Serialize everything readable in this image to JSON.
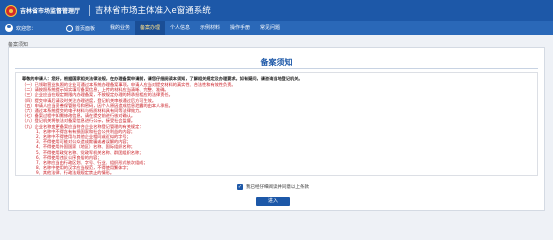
{
  "header": {
    "agency": "吉林省市场监督管理厅",
    "system_title": "吉林省市场主体准入e窗通系统"
  },
  "nav": {
    "user_label": "欢迎您：",
    "home_label": "首页面板",
    "menu": [
      {
        "label": "我的业务",
        "active": false
      },
      {
        "label": "备案办理",
        "active": true
      },
      {
        "label": "个人信息",
        "active": false
      },
      {
        "label": "示例材料",
        "active": false
      },
      {
        "label": "操作手册",
        "active": false
      },
      {
        "label": "常见问题",
        "active": false
      }
    ]
  },
  "breadcrumb": "备案须知",
  "panel": {
    "title": "备案须知",
    "notice_head": "尊敬的申请人：您好，根据国家相关法律法规，在办理备案申请前，请您仔细阅读本须知，了解相关规定及办理要求。如有疑问，请咨询当地登记机关。",
    "notice_lines": [
      "（一）已领取营业执照的企业可通过本系统办理备案事项，申请人应当对提交材料的真实性、合法性和有效性负责。",
      "（二）请按照系统提示如实填写备案信息，上传的材料应当清晰、完整、准确。",
      "（三）企业应当在规定期限内办理备案，不按规定办理的将承担相应的法律责任。",
      "（四）提交申请后请及时关注办理进度，登记机关审核通过后方可生效。",
      "（五）申请人应当妥善保管账号和密码，因个人原因造成信息泄露的由本人承担。",
      "（六）通过本系统提交的电子材料与纸质材料具有同等法律效力。",
      "（七）备案过程中如需修改信息，请在提交前进行核对确认。",
      "（八）登记机关将依法对备案信息进行公示，接受社会监督。",
      "（九）企业名称变更备案应当符合企业名称登记管理的有关规定：",
      "1、名称中不得含有有损国家和社会公共利益的内容；",
      "2、名称中不得使用与其他企业相同或近似的字号；",
      "3、不得使用可能对公众造成欺骗或者误解的内容；",
      "4、不得使用外国国家（地区）名称、国际组织名称；",
      "5、不得使用政党名称、党政军机关名称、群团组织名称；",
      "6、不得使用违反公序良俗的内容；",
      "7、名称应当由行政区划、字号、行业、组织形式依次组成；",
      "8、名称中使用的汉字应当规范，不得使用繁体字；",
      "9、其他法律、行政法规规定禁止的情形。"
    ],
    "agree_label": "我已经仔细阅读并同意以上条款",
    "enter_button": "进入"
  }
}
